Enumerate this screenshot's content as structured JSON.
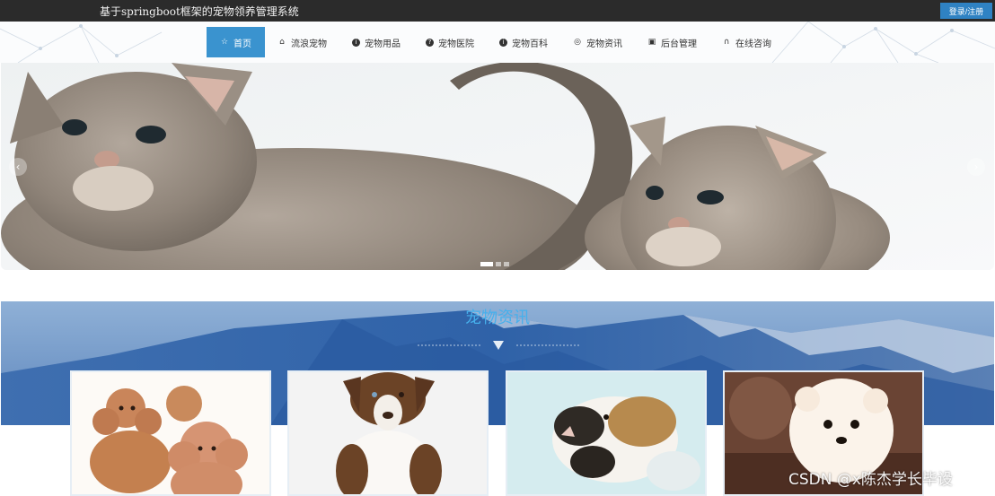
{
  "header": {
    "site_title": "基于springboot框架的宠物领养管理系统",
    "login_label": "登录/注册"
  },
  "nav": {
    "items": [
      {
        "label": "首页",
        "icon": "star-icon",
        "active": true
      },
      {
        "label": "流浪宠物",
        "icon": "home-icon"
      },
      {
        "label": "宠物用品",
        "icon": "info-icon"
      },
      {
        "label": "宠物医院",
        "icon": "question-icon"
      },
      {
        "label": "宠物百科",
        "icon": "info-icon"
      },
      {
        "label": "宠物资讯",
        "icon": "globe-icon"
      },
      {
        "label": "后台管理",
        "icon": "briefcase-icon"
      },
      {
        "label": "在线咨询",
        "icon": "headset-icon"
      }
    ]
  },
  "banner": {
    "slide_count": 3,
    "active_slide": 1
  },
  "news": {
    "title": "宠物资讯"
  },
  "watermark": "CSDN @x陈杰学长毕设",
  "colors": {
    "topbar": "#2b2b2b",
    "accent": "#3a93cf",
    "login": "#2f82c3",
    "section_title": "#46b0ec"
  }
}
